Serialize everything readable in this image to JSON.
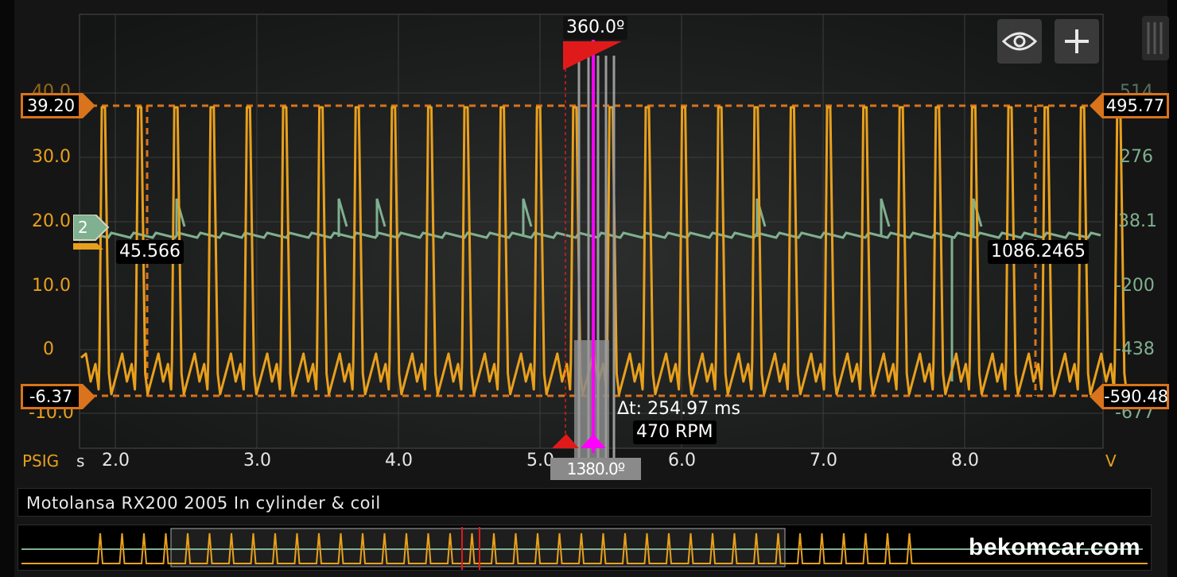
{
  "channel_a": {
    "unit": "PSIG",
    "ticks": [
      "30.0",
      "20.0",
      "10.0",
      "0",
      "-10.0"
    ],
    "top_tick_partial": "40.0",
    "upper_level": "39.20",
    "lower_level": "-6.37",
    "color": "#e8a01c"
  },
  "channel_b": {
    "unit": "V",
    "ticks": [
      "276",
      "38.1",
      "-200",
      "-438",
      "-677"
    ],
    "top_tick_partial": "514",
    "upper_level": "495.77",
    "lower_level": "-590.48",
    "badge": "2",
    "color": "#7fb08f"
  },
  "time_axis": {
    "unit": "s",
    "ticks": [
      "2.0",
      "3.0",
      "4.0",
      "5.0",
      "6.0",
      "7.0",
      "8.0"
    ]
  },
  "cursors": {
    "left_value": "45.566",
    "right_value": "1086.2465",
    "angle_label": "360.0º",
    "delta_t": "Δt: 254.97 ms",
    "rpm": "470 RPM",
    "marker_labels": "1380.0º"
  },
  "buttons": {
    "visibility_icon": "eye-icon",
    "add_icon": "plus-icon"
  },
  "capture_title": "Motolansa RX200 2005 In cylinder & coil",
  "watermark": "bekomcar.com",
  "colors": {
    "pressure_trace": "#e8a01c",
    "coil_trace": "#7fb08f",
    "cursor_magenta": "#ff00ff",
    "trigger_red": "#e01a1a",
    "level_orange": "#d9731c"
  }
}
